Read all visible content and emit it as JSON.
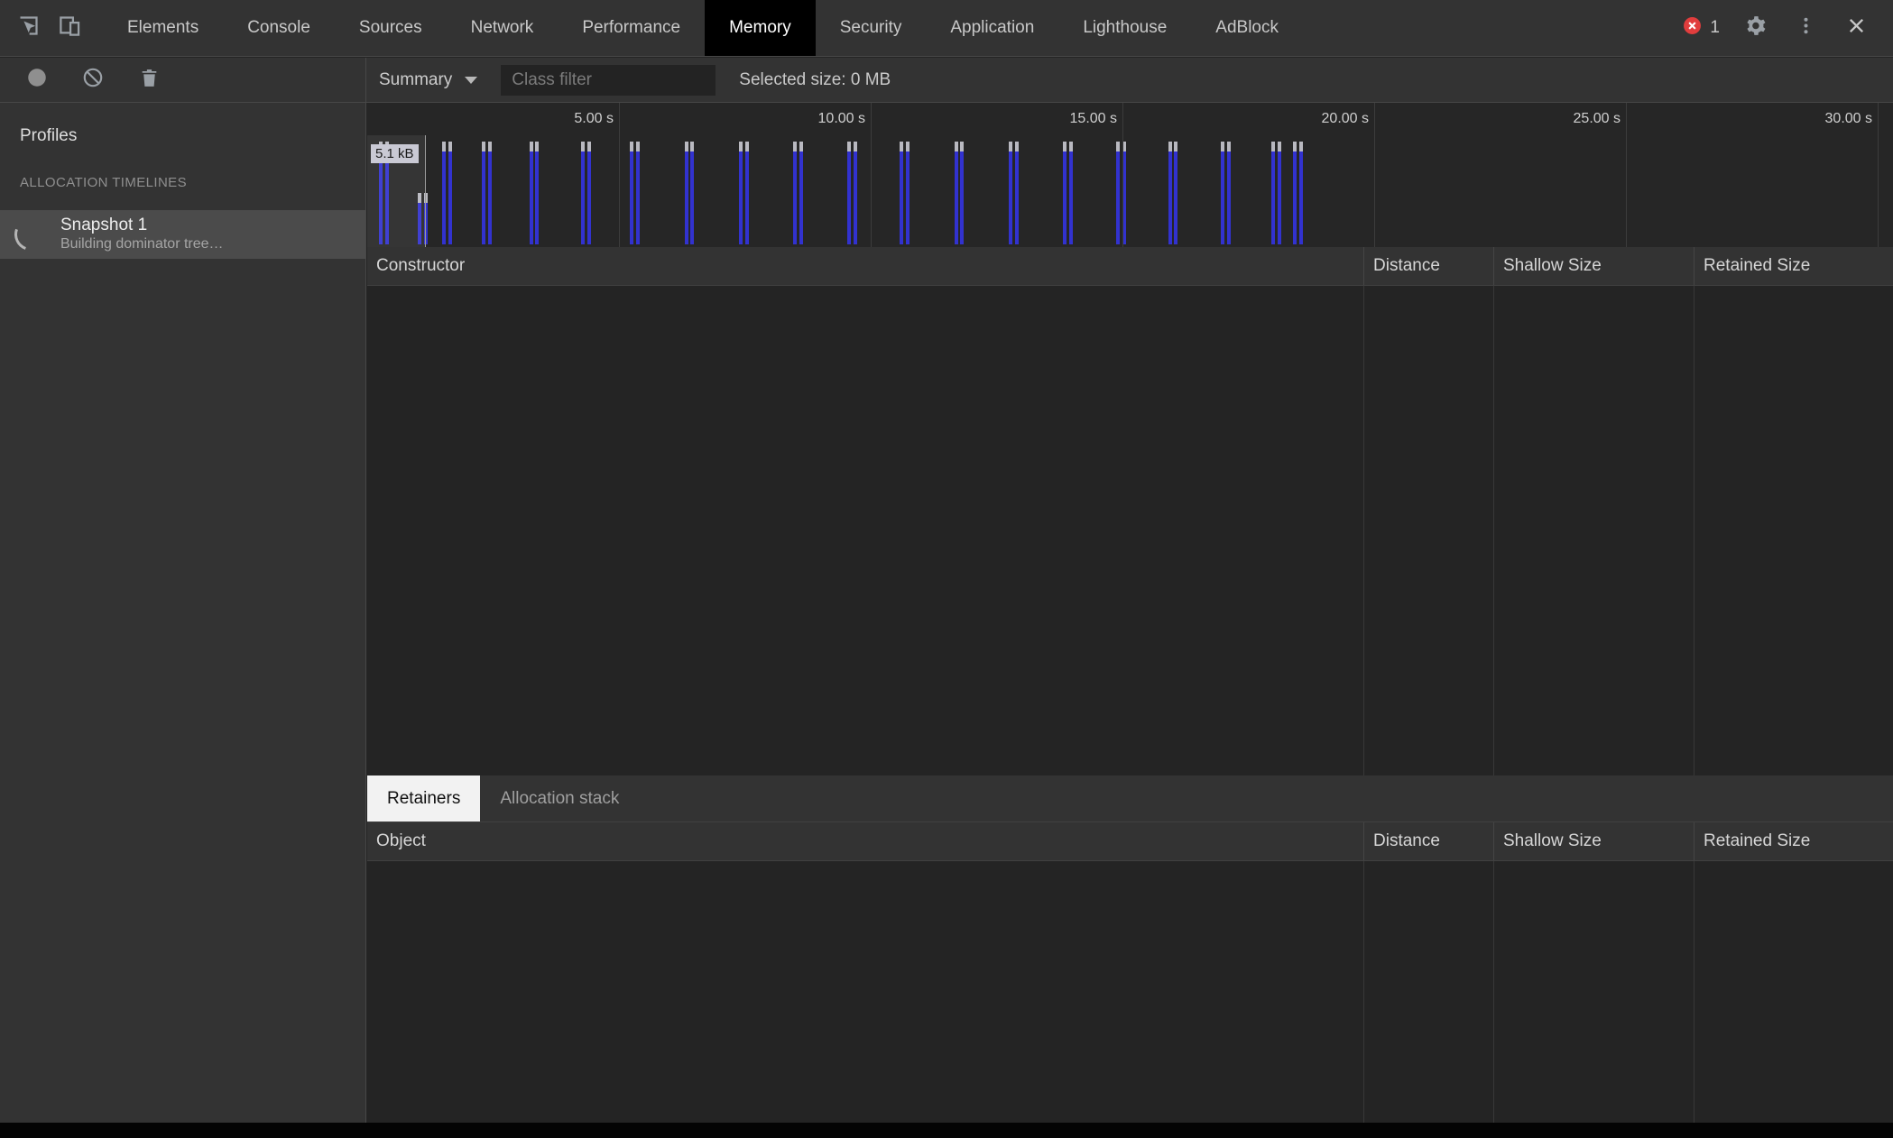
{
  "tabbar": {
    "tabs": [
      "Elements",
      "Console",
      "Sources",
      "Network",
      "Performance",
      "Memory",
      "Security",
      "Application",
      "Lighthouse",
      "AdBlock"
    ],
    "active_tab": "Memory",
    "error_count": "1"
  },
  "toolbar": {
    "summary_label": "Summary",
    "class_filter_placeholder": "Class filter",
    "selected_size_label": "Selected size: 0 MB"
  },
  "sidebar": {
    "profiles_label": "Profiles",
    "section_label": "ALLOCATION TIMELINES",
    "snapshot_title": "Snapshot 1",
    "snapshot_subtitle": "Building dominator tree…"
  },
  "timeline": {
    "time_labels": [
      "5.00 s",
      "10.00 s",
      "15.00 s",
      "20.00 s",
      "25.00 s",
      "30.00 s"
    ],
    "seconds_per_label": 5,
    "axis_range_seconds": [
      0,
      30
    ],
    "selection_label": "5.1 kB",
    "bars": [
      {
        "t": 0.24,
        "h": 1.0
      },
      {
        "t": 0.36,
        "h": 1.0
      },
      {
        "t": 1.01,
        "h": 0.5
      },
      {
        "t": 1.13,
        "h": 0.5
      },
      {
        "t": 1.49,
        "h": 1.0
      },
      {
        "t": 1.61,
        "h": 1.0
      },
      {
        "t": 2.28,
        "h": 1.0
      },
      {
        "t": 2.4,
        "h": 1.0
      },
      {
        "t": 3.22,
        "h": 1.0
      },
      {
        "t": 3.34,
        "h": 1.0
      },
      {
        "t": 4.25,
        "h": 1.0
      },
      {
        "t": 4.37,
        "h": 1.0
      },
      {
        "t": 5.22,
        "h": 1.0
      },
      {
        "t": 5.34,
        "h": 1.0
      },
      {
        "t": 6.3,
        "h": 1.0
      },
      {
        "t": 6.42,
        "h": 1.0
      },
      {
        "t": 7.38,
        "h": 1.0
      },
      {
        "t": 7.5,
        "h": 1.0
      },
      {
        "t": 8.46,
        "h": 1.0
      },
      {
        "t": 8.58,
        "h": 1.0
      },
      {
        "t": 9.54,
        "h": 1.0
      },
      {
        "t": 9.66,
        "h": 1.0
      },
      {
        "t": 10.58,
        "h": 1.0
      },
      {
        "t": 10.7,
        "h": 1.0
      },
      {
        "t": 11.66,
        "h": 1.0
      },
      {
        "t": 11.78,
        "h": 1.0
      },
      {
        "t": 12.74,
        "h": 1.0
      },
      {
        "t": 12.86,
        "h": 1.0
      },
      {
        "t": 13.82,
        "h": 1.0
      },
      {
        "t": 13.94,
        "h": 1.0
      },
      {
        "t": 14.88,
        "h": 1.0
      },
      {
        "t": 15.0,
        "h": 1.0
      },
      {
        "t": 15.91,
        "h": 1.0
      },
      {
        "t": 16.03,
        "h": 1.0
      },
      {
        "t": 16.95,
        "h": 1.0
      },
      {
        "t": 17.07,
        "h": 1.0
      },
      {
        "t": 17.96,
        "h": 1.0
      },
      {
        "t": 18.08,
        "h": 1.0
      },
      {
        "t": 18.39,
        "h": 1.0
      },
      {
        "t": 18.51,
        "h": 1.0
      }
    ]
  },
  "constructor_table": {
    "headers": [
      "Constructor",
      "Distance",
      "Shallow Size",
      "Retained Size"
    ]
  },
  "retainers_panel": {
    "tabs": [
      "Retainers",
      "Allocation stack"
    ],
    "active_tab": "Retainers"
  },
  "object_table": {
    "headers": [
      "Object",
      "Distance",
      "Shallow Size",
      "Retained Size"
    ]
  },
  "colors": {
    "accent_bar": "#3232cf",
    "bar_cap": "#b9b9c0",
    "error_red": "#e13d3d",
    "active_tab_bg": "#000000",
    "retainer_active_bg": "#f2f2f2"
  }
}
